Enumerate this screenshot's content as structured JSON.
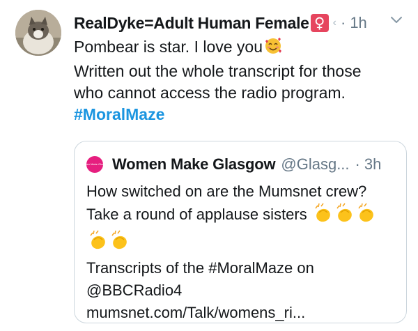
{
  "tweet": {
    "display_name": "RealDyke=Adult Human Female",
    "badge_icon": "female-sign-icon",
    "badge_symbol": "♀",
    "truncation_mark": "‹",
    "separator": "·",
    "time": "1h",
    "menu_icon": "chevron-down-icon",
    "avatar_icon": "cat-photo-avatar",
    "body_line1": "Pombear is star. I love you",
    "body_emoji": "smiling-face-with-hearts-icon",
    "body_line2": "Written out the whole transcript for those",
    "body_line3": "who cannot access the radio program.",
    "hashtag": "#MoralMaze"
  },
  "quote": {
    "display_name": "Women Make Glasgow",
    "handle": "@Glasg...",
    "separator": "·",
    "time": "3h",
    "avatar_text": "Women Make Glasgow",
    "line1": "How switched on are the Mumsnet crew?",
    "line2": "Take a round of applause sisters",
    "clap_icon": "clapping-hands-icon",
    "clap_count": 5,
    "line4": "Transcripts of the #MoralMaze on",
    "line5": "@BBCRadio4",
    "line6": "mumsnet.com/Talk/womens_ri..."
  },
  "colors": {
    "text": "#14171a",
    "secondary": "#657786",
    "link": "#1b95e0",
    "border": "#ccd6dd",
    "badge": "#e6455e",
    "quote_avatar": "#e61e7f"
  }
}
